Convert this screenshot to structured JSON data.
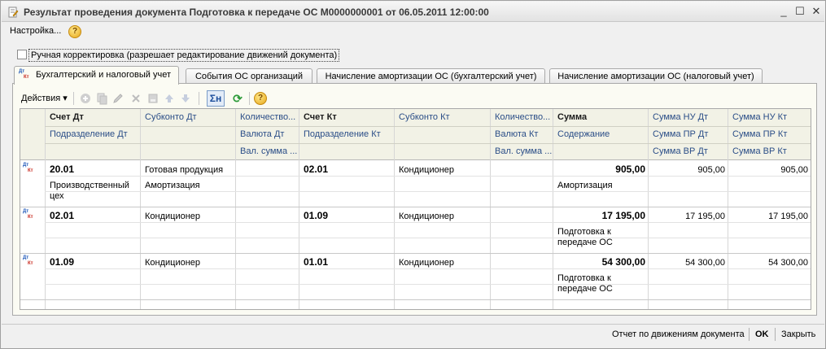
{
  "window": {
    "title": "Результат проведения документа Подготовка к передаче ОС М0000000001 от 06.05.2011 12:00:00",
    "minimize": "_",
    "maximize": "☐",
    "close": "✕"
  },
  "menu": {
    "settings": "Настройка...",
    "help": "?"
  },
  "manual": {
    "label": "Ручная корректировка (разрешает редактирование движений документа)",
    "checked": false
  },
  "tabs": [
    {
      "label": "Бухгалтерский и налоговый учет",
      "active": true
    },
    {
      "label": "События ОС организаций"
    },
    {
      "label": "Начисление амортизации ОС (бухгалтерский учет)"
    },
    {
      "label": "Начисление амортизации ОС (налоговый учет)"
    }
  ],
  "icon_labels": {
    "dt": "Дт",
    "kt": "Кт"
  },
  "toolbar": {
    "actions": "Действия",
    "actions_arrow": "▾",
    "sum_label": "Σн",
    "refresh": "⟳",
    "help": "?"
  },
  "columns": {
    "r1": [
      "Счет Дт",
      "Субконто Дт",
      "Количество...",
      "Счет Кт",
      "Субконто Кт",
      "Количество...",
      "Сумма",
      "Сумма НУ Дт",
      "Сумма НУ Кт"
    ],
    "r2": [
      "Подразделение Дт",
      "",
      "Валюта Дт",
      "Подразделение Кт",
      "",
      "Валюта Кт",
      "Содержание",
      "Сумма ПР Дт",
      "Сумма ПР Кт"
    ],
    "r3": [
      "",
      "",
      "Вал. сумма ...",
      "",
      "",
      "Вал. сумма ...",
      "",
      "Сумма ВР Дт",
      "Сумма ВР Кт"
    ]
  },
  "rows": [
    {
      "acct_dt": "20.01",
      "sub_dt1": "Готовая продукция",
      "sub_dt2": "Амортизация",
      "dept_dt": "Производственный цех",
      "acct_kt": "02.01",
      "sub_kt": "Кондиционер",
      "sum": "905,00",
      "content": "Амортизация",
      "nu_dt": "905,00",
      "nu_kt": "905,00"
    },
    {
      "acct_dt": "02.01",
      "sub_dt1": "Кондиционер",
      "sub_dt2": "",
      "dept_dt": "",
      "acct_kt": "01.09",
      "sub_kt": "Кондиционер",
      "sum": "17 195,00",
      "content": "Подготовка к передаче ОС",
      "nu_dt": "17 195,00",
      "nu_kt": "17 195,00"
    },
    {
      "acct_dt": "01.09",
      "sub_dt1": "Кондиционер",
      "sub_dt2": "",
      "dept_dt": "",
      "acct_kt": "01.01",
      "sub_kt": "Кондиционер",
      "sum": "54 300,00",
      "content": "Подготовка к передаче ОС",
      "nu_dt": "54 300,00",
      "nu_kt": "54 300,00"
    }
  ],
  "status": {
    "report": "Отчет по движениям документа",
    "ok": "OK",
    "close": "Закрыть"
  },
  "colors": {
    "header_text": "#2a4d87",
    "dt_blue": "#1f58b9",
    "kt_red": "#c8281e",
    "panel_bg": "#fbfbf3"
  }
}
